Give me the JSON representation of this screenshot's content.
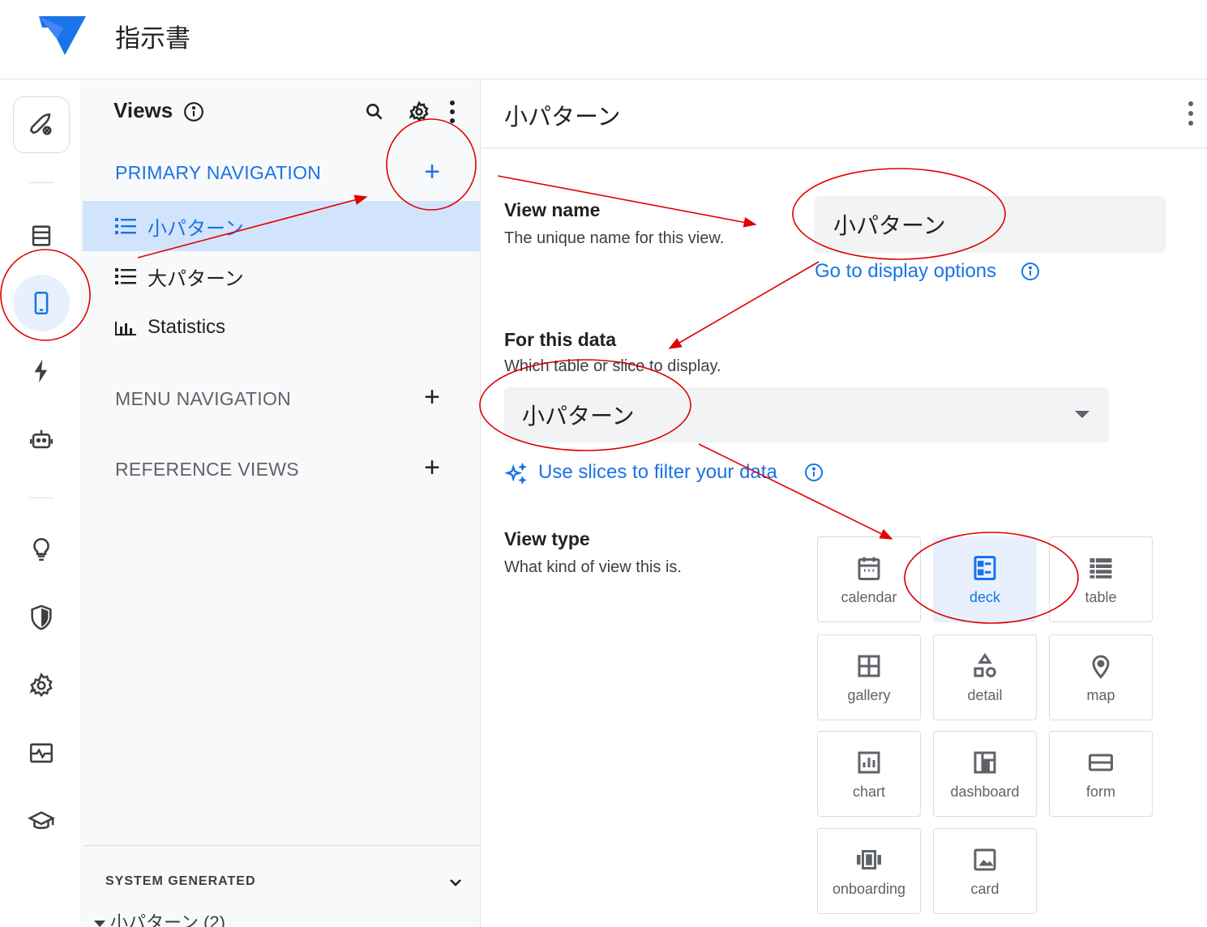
{
  "app": {
    "title": "指示書",
    "brand_color": "#1a73e8",
    "logo_icon": "appsheet-logo-icon"
  },
  "rail": {
    "items": [
      {
        "icon": "rocket-icon"
      },
      {
        "icon": "data-icon"
      },
      {
        "icon": "phone-icon",
        "active": true
      },
      {
        "icon": "bolt-icon"
      },
      {
        "icon": "robot-icon"
      },
      {
        "icon": "lightbulb-icon"
      },
      {
        "icon": "shield-icon"
      },
      {
        "icon": "gear-icon"
      },
      {
        "icon": "monitor-icon"
      },
      {
        "icon": "school-icon"
      }
    ]
  },
  "views_panel": {
    "title": "Views",
    "sections": {
      "primary": {
        "label": "PRIMARY NAVIGATION",
        "add": "+"
      },
      "menu": {
        "label": "MENU NAVIGATION",
        "add": "+"
      },
      "reference": {
        "label": "REFERENCE VIEWS",
        "add": "+"
      }
    },
    "primary_items": [
      {
        "label": "小パターン",
        "icon": "list-icon",
        "selected": true
      },
      {
        "label": "大パターン",
        "icon": "list-icon"
      },
      {
        "label": "Statistics",
        "icon": "bar-chart-icon"
      }
    ],
    "system_generated": {
      "label": "SYSTEM GENERATED",
      "first_item": "小パターン (2)"
    }
  },
  "main": {
    "title": "小パターン",
    "view_name": {
      "label": "View name",
      "desc": "The unique name for this view.",
      "value": "小パターン",
      "link": "Go to display options"
    },
    "for_this_data": {
      "label": "For this data",
      "desc": "Which table or slice to display.",
      "value": "小パターン",
      "link": "Use slices to filter your data"
    },
    "view_type": {
      "label": "View type",
      "desc": "What kind of view this is.",
      "selected": "deck",
      "options": [
        {
          "label": "calendar",
          "icon": "calendar-icon"
        },
        {
          "label": "deck",
          "icon": "deck-icon"
        },
        {
          "label": "table",
          "icon": "table-icon"
        },
        {
          "label": "gallery",
          "icon": "gallery-icon"
        },
        {
          "label": "detail",
          "icon": "detail-icon"
        },
        {
          "label": "map",
          "icon": "map-pin-icon"
        },
        {
          "label": "chart",
          "icon": "chart-icon"
        },
        {
          "label": "dashboard",
          "icon": "dashboard-icon"
        },
        {
          "label": "form",
          "icon": "form-icon"
        },
        {
          "label": "onboarding",
          "icon": "onboarding-icon"
        },
        {
          "label": "card",
          "icon": "image-card-icon"
        }
      ]
    }
  },
  "annotation_color": "#e00000"
}
